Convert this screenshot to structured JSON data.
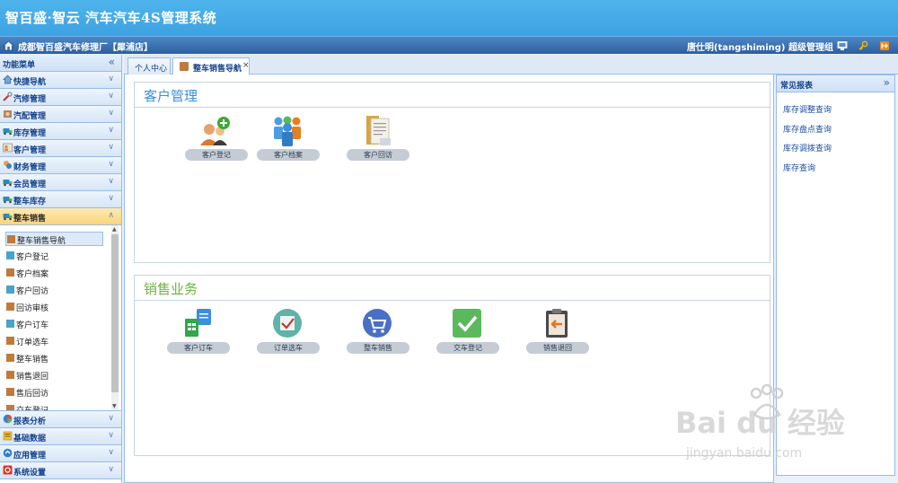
{
  "app": {
    "title": "智百盛·智云 汽车汽车4S管理系统",
    "shop_name": "成都智百盛汽车修理厂【犀浦店】",
    "user_info": "唐仕明(tangshiming) 超级管理组"
  },
  "sidebar": {
    "header": "功能菜单",
    "collapse_glyph": "«",
    "items_top": [
      {
        "label": "快捷导航",
        "icon": "home-icon"
      },
      {
        "label": "汽修管理",
        "icon": "wrench-icon"
      },
      {
        "label": "汽配管理",
        "icon": "parts-icon"
      },
      {
        "label": "库存管理",
        "icon": "truck-icon"
      },
      {
        "label": "客户管理",
        "icon": "customer-icon"
      },
      {
        "label": "财务管理",
        "icon": "finance-icon"
      },
      {
        "label": "会员管理",
        "icon": "member-icon"
      },
      {
        "label": "整车库存",
        "icon": "truck-icon"
      },
      {
        "label": "整车销售",
        "icon": "truck-icon",
        "active": true
      }
    ],
    "sub_items": [
      {
        "label": "整车销售导航",
        "selected": true
      },
      {
        "label": "客户登记"
      },
      {
        "label": "客户档案"
      },
      {
        "label": "客户回访"
      },
      {
        "label": "回访审核"
      },
      {
        "label": "客户订车"
      },
      {
        "label": "订单选车"
      },
      {
        "label": "整车销售"
      },
      {
        "label": "销售退回"
      },
      {
        "label": "售后回访"
      },
      {
        "label": "交车登记"
      }
    ],
    "items_bottom": [
      {
        "label": "报表分析",
        "icon": "pie-chart-icon"
      },
      {
        "label": "基础数据",
        "icon": "data-icon"
      },
      {
        "label": "应用管理",
        "icon": "app-icon"
      },
      {
        "label": "系统设置",
        "icon": "settings-icon"
      }
    ]
  },
  "tabs": [
    {
      "label": "个人中心"
    },
    {
      "label": "整车销售导航",
      "active": true,
      "close": "×"
    }
  ],
  "panels": {
    "customer": {
      "title": "客户管理",
      "title_color": "#3a8fd8",
      "apps": [
        "客户登记",
        "客户档案",
        "客户回访"
      ]
    },
    "sales": {
      "title": "销售业务",
      "title_color": "#6db33f",
      "apps": [
        "客户订车",
        "订单选车",
        "整车销售",
        "交车登记",
        "销售退回"
      ]
    }
  },
  "right_panel": {
    "title": "常见报表",
    "expand_glyph": "»",
    "links": [
      "库存调整查询",
      "库存盘点查询",
      "库存调拨查询",
      "库存查询"
    ]
  },
  "watermark": {
    "text1": "Bai  du 经验",
    "text2": "jingyan.baidu.com"
  }
}
